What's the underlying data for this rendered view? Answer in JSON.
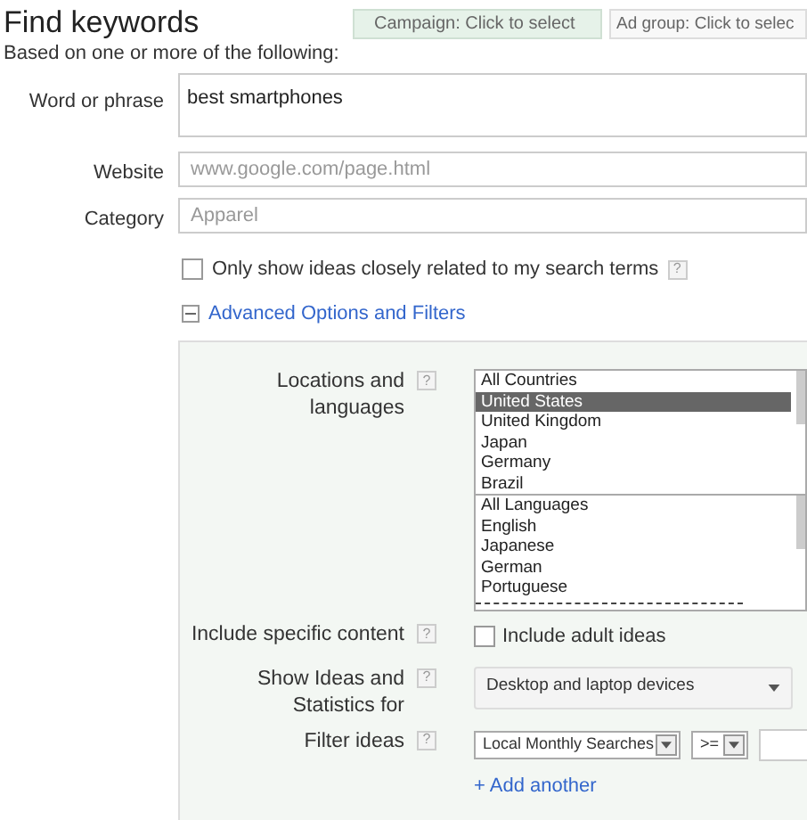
{
  "title": "Find keywords",
  "campaign_selector": "Campaign: Click to select",
  "ad_group_selector": "Ad group: Click to selec",
  "subtitle": "Based on one or more of the following:",
  "fields": [
    {
      "label": "Word or phrase",
      "value": "best smartphones",
      "kind": "textarea"
    },
    {
      "label": "Website",
      "placeholder": "www.google.com/page.html",
      "kind": "input"
    },
    {
      "label": "Category",
      "placeholder": "Apparel",
      "kind": "input"
    }
  ],
  "closely_related": {
    "label": "Only show ideas closely related to my search terms",
    "checked": false,
    "help": "?"
  },
  "advanced": {
    "label": "Advanced Options and Filters",
    "expanded": true
  },
  "locations_label": "Locations and languages",
  "locations_help": "?",
  "countries": [
    {
      "label": "All Countries",
      "selected": false
    },
    {
      "label": "United States",
      "selected": true
    },
    {
      "label": "United Kingdom",
      "selected": false
    },
    {
      "label": "Japan",
      "selected": false
    },
    {
      "label": "Germany",
      "selected": false
    },
    {
      "label": "Brazil",
      "selected": false
    }
  ],
  "languages": [
    {
      "label": "All Languages",
      "selected": false
    },
    {
      "label": "English",
      "selected": false
    },
    {
      "label": "Japanese",
      "selected": false
    },
    {
      "label": "German",
      "selected": false
    },
    {
      "label": "Portuguese",
      "selected": false
    }
  ],
  "include_content": {
    "label": "Include specific content",
    "option": "Include adult ideas",
    "checked": false,
    "help": "?"
  },
  "show_ideas": {
    "label": "Show Ideas and Statistics for",
    "value": "Desktop and laptop devices",
    "help": "?"
  },
  "filter": {
    "label": "Filter ideas",
    "metric": "Local Monthly Searches",
    "operator": ">=",
    "add": "+ Add another",
    "help": "?"
  }
}
